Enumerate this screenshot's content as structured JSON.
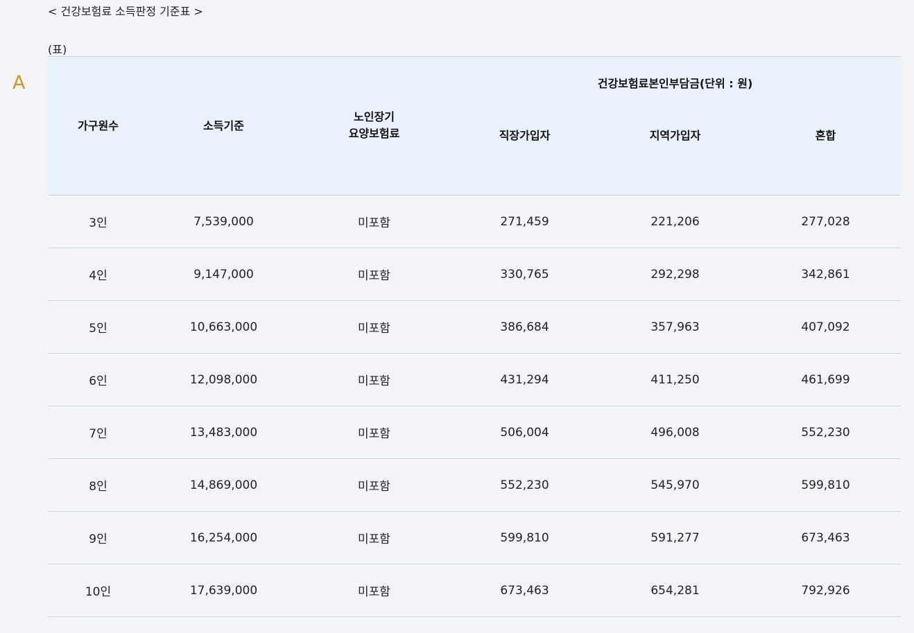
{
  "caption": "< 건강보험료 소득판정 기준표 >",
  "side_letter": "A",
  "table_label": "(표)",
  "table": {
    "headers": {
      "household": "가구원수",
      "income": "소득기준",
      "ltc_line1": "노인장기",
      "ltc_line2": "요양보험료",
      "group": "건강보험료본인부담금(단위 : 원)",
      "workplace": "직장가입자",
      "regional": "지역가입자",
      "mixed": "혼합"
    },
    "rows": [
      {
        "household": "3인",
        "income": "7,539,000",
        "ltc": "미포함",
        "workplace": "271,459",
        "regional": "221,206",
        "mixed": "277,028"
      },
      {
        "household": "4인",
        "income": "9,147,000",
        "ltc": "미포함",
        "workplace": "330,765",
        "regional": "292,298",
        "mixed": "342,861"
      },
      {
        "household": "5인",
        "income": "10,663,000",
        "ltc": "미포함",
        "workplace": "386,684",
        "regional": "357,963",
        "mixed": "407,092"
      },
      {
        "household": "6인",
        "income": "12,098,000",
        "ltc": "미포함",
        "workplace": "431,294",
        "regional": "411,250",
        "mixed": "461,699"
      },
      {
        "household": "7인",
        "income": "13,483,000",
        "ltc": "미포함",
        "workplace": "506,004",
        "regional": "496,008",
        "mixed": "552,230"
      },
      {
        "household": "8인",
        "income": "14,869,000",
        "ltc": "미포함",
        "workplace": "552,230",
        "regional": "545,970",
        "mixed": "599,810"
      },
      {
        "household": "9인",
        "income": "16,254,000",
        "ltc": "미포함",
        "workplace": "599,810",
        "regional": "591,277",
        "mixed": "673,463"
      },
      {
        "household": "10인",
        "income": "17,639,000",
        "ltc": "미포함",
        "workplace": "673,463",
        "regional": "654,281",
        "mixed": "792,926"
      }
    ]
  }
}
